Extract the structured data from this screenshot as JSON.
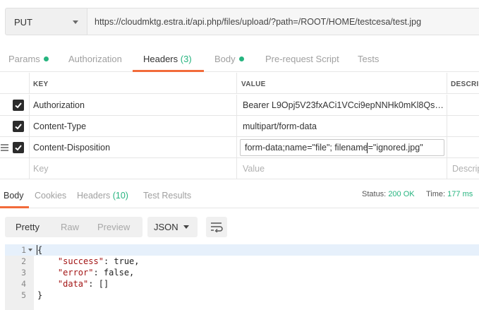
{
  "request": {
    "method": "PUT",
    "url": "https://cloudmktg.estra.it/api.php/files/upload/?path=/ROOT/HOME/testcesa/test.jpg"
  },
  "request_tabs": [
    {
      "label": "Params",
      "dot": true
    },
    {
      "label": "Authorization"
    },
    {
      "label": "Headers",
      "count": "(3)",
      "active": true
    },
    {
      "label": "Body",
      "dot": true
    },
    {
      "label": "Pre-request Script"
    },
    {
      "label": "Tests"
    }
  ],
  "headers_table": {
    "columns": [
      "KEY",
      "VALUE",
      "DESCRIPTION"
    ],
    "rows": [
      {
        "key": "Authorization",
        "value": "Bearer L9Opj5V23fxACi1VCci9epNNHk0mKl8QsF...",
        "checked": true
      },
      {
        "key": "Content-Type",
        "value": "multipart/form-data",
        "checked": true
      },
      {
        "key": "Content-Disposition",
        "value": "form-data;name=\"file\"; filename=\"ignored.jpg\"",
        "checked": true,
        "editing": true
      }
    ],
    "placeholder": {
      "key": "Key",
      "value": "Value",
      "description": "Description"
    }
  },
  "response_tabs": [
    {
      "label": "Body",
      "active": true
    },
    {
      "label": "Cookies"
    },
    {
      "label": "Headers",
      "count": "(10)"
    },
    {
      "label": "Test Results"
    }
  ],
  "response_status": {
    "status_label": "Status:",
    "status_value": "200 OK",
    "time_label": "Time:",
    "time_value": "177 ms"
  },
  "view_modes": {
    "buttons": [
      "Pretty",
      "Raw",
      "Preview"
    ],
    "active": "Pretty",
    "format": "JSON"
  },
  "code_lines": [
    {
      "n": "1",
      "text": "{"
    },
    {
      "n": "2",
      "key": "\"success\"",
      "rest": ": true,"
    },
    {
      "n": "3",
      "key": "\"error\"",
      "rest": ": false,"
    },
    {
      "n": "4",
      "key": "\"data\"",
      "rest": ": []"
    },
    {
      "n": "5",
      "text": "}"
    }
  ],
  "colors": {
    "accent": "#f26b3a",
    "success": "#26b47f",
    "checkbox": "#2b2b2b"
  },
  "icons": [
    "chevron-down-icon",
    "checkbox-checked-icon",
    "drag-handle-icon",
    "wrap-lines-icon",
    "fold-arrow-icon"
  ]
}
